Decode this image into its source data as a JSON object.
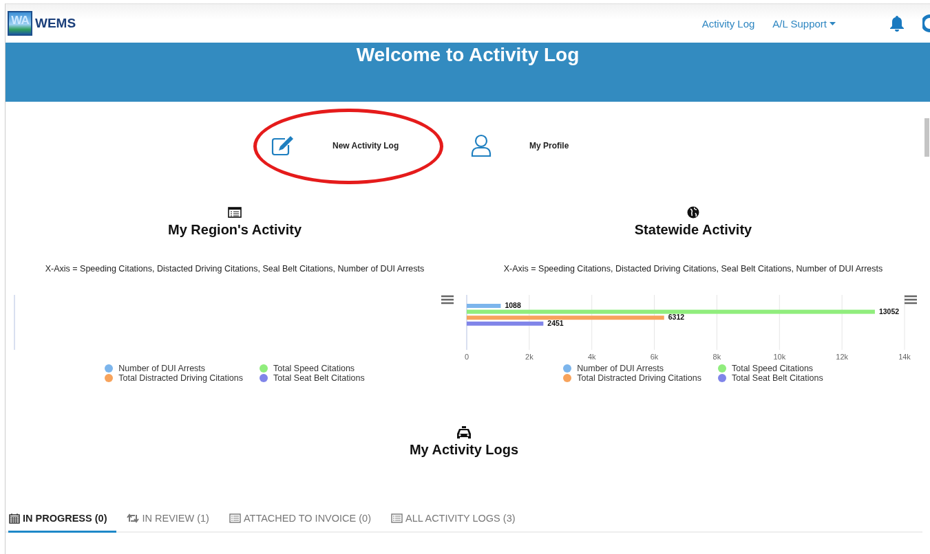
{
  "header": {
    "logo_mark": "WA",
    "logo_text": "WEMS",
    "nav": [
      {
        "label": "Activity Log",
        "kind": "link"
      },
      {
        "label": "A/L Support",
        "kind": "dropdown"
      }
    ]
  },
  "banner": {
    "title": "Welcome to Activity Log"
  },
  "quick_links": [
    {
      "label": "New Activity Log",
      "kind": "edit",
      "circled": true
    },
    {
      "label": "My Profile",
      "kind": "profile",
      "circled": false
    }
  ],
  "charts": [
    {
      "title": "My Region's Activity",
      "kind": "list",
      "caption": "X-Axis = Speeding Citations, Distacted Driving Citations, Seal Belt Citations, Number of DUI Arrests",
      "legend": [
        {
          "name": "Number of DUI Arrests",
          "color": "#7cb5ec"
        },
        {
          "name": "Total Speed Citations",
          "color": "#90ed7d"
        },
        {
          "name": "Total Distracted Driving Citations",
          "color": "#f7a35c"
        },
        {
          "name": "Total Seat Belt Citations",
          "color": "#8085e9"
        }
      ]
    },
    {
      "title": "Statewide Activity",
      "kind": "globe",
      "caption": "X-Axis = Speeding Citations, Distacted Driving Citations, Seal Belt Citations, Number of DUI Arrests",
      "chart_data": {
        "type": "bar",
        "orientation": "horizontal",
        "categories": [
          null
        ],
        "data_labels": true,
        "grid": true,
        "xlim": [
          0,
          14000
        ],
        "xticks": [
          {
            "value": 0,
            "label": "0"
          },
          {
            "value": 2000,
            "label": "2k"
          },
          {
            "value": 4000,
            "label": "4k"
          },
          {
            "value": 6000,
            "label": "6k"
          },
          {
            "value": 8000,
            "label": "8k"
          },
          {
            "value": 10000,
            "label": "10k"
          },
          {
            "value": 12000,
            "label": "12k"
          },
          {
            "value": 14000,
            "label": "14k"
          }
        ],
        "series": [
          {
            "name": "Number of DUI Arrests",
            "color": "#7cb5ec",
            "values": [
              1088
            ]
          },
          {
            "name": "Total Speed Citations",
            "color": "#90ed7d",
            "values": [
              13052
            ]
          },
          {
            "name": "Total Distracted Driving Citations",
            "color": "#f7a35c",
            "values": [
              6312
            ]
          },
          {
            "name": "Total Seat Belt Citations",
            "color": "#8085e9",
            "values": [
              2451
            ]
          }
        ]
      }
    }
  ],
  "logs": {
    "title": "My Activity Logs",
    "tabs": [
      {
        "label": "IN PROGRESS (0)",
        "kind": "calendar",
        "selected": true
      },
      {
        "label": "IN REVIEW (1)",
        "kind": "retweet",
        "selected": false
      },
      {
        "label": "ATTACHED TO INVOICE (0)",
        "kind": "list",
        "selected": false
      },
      {
        "label": "ALL ACTIVITY LOGS (3)",
        "kind": "list",
        "selected": false
      }
    ]
  }
}
